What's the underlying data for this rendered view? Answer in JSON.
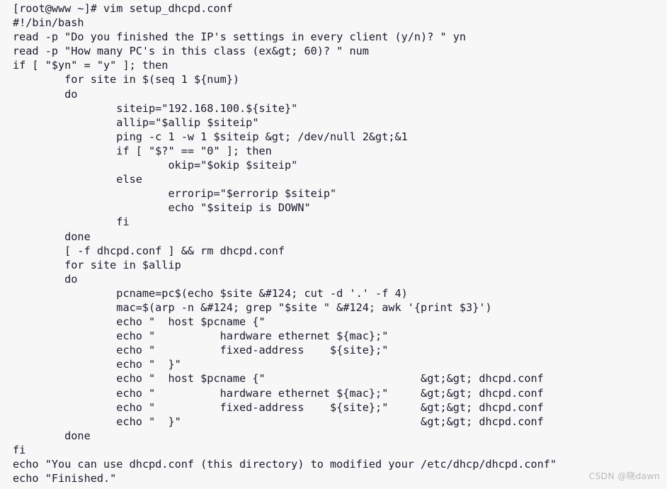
{
  "terminal": {
    "background_color": "#f7f7f7",
    "text_color": "#1a1a2e",
    "prompt": "[root@www ~]#",
    "command": "vim setup_dhcpd.conf",
    "filename": "setup_dhcpd.conf",
    "lines": [
      "[root@www ~]# vim setup_dhcpd.conf",
      "#!/bin/bash",
      "read -p \"Do you finished the IP's settings in every client (y/n)? \" yn",
      "read -p \"How many PC's in this class (ex&gt; 60)? \" num",
      "if [ \"$yn\" = \"y\" ]; then",
      "        for site in $(seq 1 ${num})",
      "        do",
      "                siteip=\"192.168.100.${site}\"",
      "                allip=\"$allip $siteip\"",
      "                ping -c 1 -w 1 $siteip &gt; /dev/null 2&gt;&1",
      "                if [ \"$?\" == \"0\" ]; then",
      "                        okip=\"$okip $siteip\"",
      "                else",
      "                        errorip=\"$errorip $siteip\"",
      "                        echo \"$siteip is DOWN\"",
      "                fi",
      "        done",
      "        [ -f dhcpd.conf ] && rm dhcpd.conf",
      "        for site in $allip",
      "        do",
      "                pcname=pc$(echo $site &#124; cut -d '.' -f 4)",
      "                mac=$(arp -n &#124; grep \"$site \" &#124; awk '{print $3}')",
      "                echo \"  host $pcname {\"",
      "                echo \"          hardware ethernet ${mac};\"",
      "                echo \"          fixed-address    ${site};\"",
      "                echo \"  }\"",
      "                echo \"  host $pcname {\"                        &gt;&gt; dhcpd.conf",
      "                echo \"          hardware ethernet ${mac};\"     &gt;&gt; dhcpd.conf",
      "                echo \"          fixed-address    ${site};\"     &gt;&gt; dhcpd.conf",
      "                echo \"  }\"                                     &gt;&gt; dhcpd.conf",
      "        done",
      "fi",
      "echo \"You can use dhcpd.conf (this directory) to modified your /etc/dhcp/dhcpd.conf\"",
      "echo \"Finished.\""
    ]
  },
  "watermark": {
    "text": "CSDN @晓dawn",
    "color": "#b9b9b9"
  }
}
